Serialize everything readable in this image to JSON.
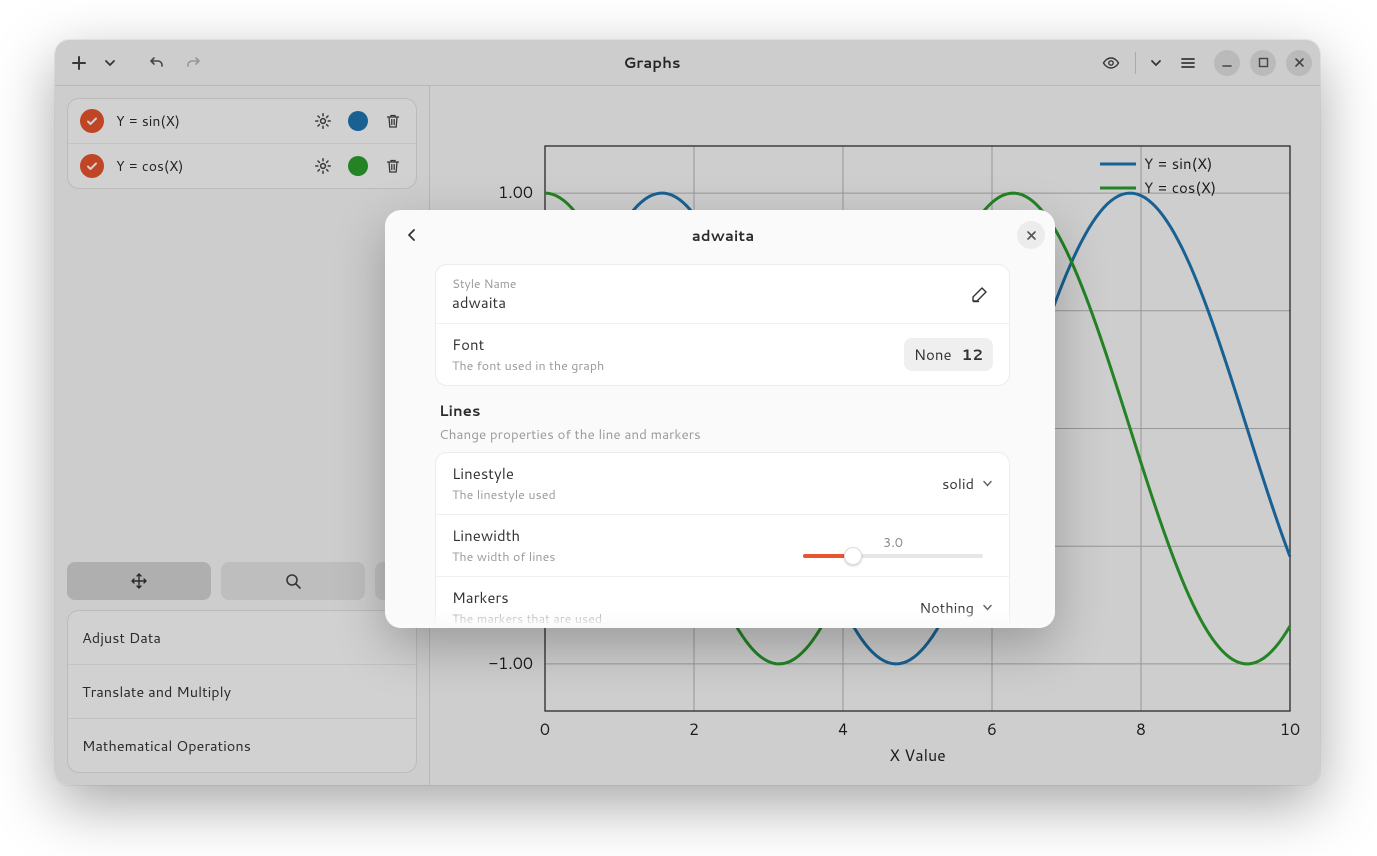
{
  "header": {
    "title": "Graphs"
  },
  "sidebar": {
    "equations": [
      {
        "label": "Y = sin(X)",
        "color": "#1f77b4"
      },
      {
        "label": "Y = cos(X)",
        "color": "#2ca02c"
      }
    ],
    "accordion": [
      "Adjust Data",
      "Translate and Multiply",
      "Mathematical Operations"
    ]
  },
  "chart": {
    "xlabel": "X Value",
    "legend": [
      "Y = sin(X)",
      "Y = cos(X)"
    ],
    "yticks": [
      "1.00",
      "−1.00"
    ],
    "xticks": [
      "0",
      "2",
      "4",
      "6",
      "8",
      "10"
    ]
  },
  "chart_data": {
    "type": "line",
    "title": "",
    "xlabel": "X Value",
    "ylabel": "",
    "xlim": [
      0,
      10
    ],
    "ylim": [
      -1.2,
      1.2
    ],
    "x": [
      0,
      0.5,
      1,
      1.5,
      2,
      2.5,
      3,
      3.5,
      4,
      4.5,
      5,
      5.5,
      6,
      6.5,
      7,
      7.5,
      8,
      8.5,
      9,
      9.5,
      10
    ],
    "series": [
      {
        "name": "Y = sin(X)",
        "color": "#1f77b4",
        "values": [
          0,
          0.479,
          0.841,
          0.997,
          0.909,
          0.599,
          0.141,
          -0.351,
          -0.757,
          -0.978,
          -0.959,
          -0.706,
          -0.279,
          0.215,
          0.657,
          0.938,
          0.989,
          0.798,
          0.412,
          -0.075,
          -0.544
        ]
      },
      {
        "name": "Y = cos(X)",
        "color": "#2ca02c",
        "values": [
          1,
          0.878,
          0.54,
          0.071,
          -0.416,
          -0.801,
          -0.99,
          -0.936,
          -0.654,
          -0.211,
          0.284,
          0.709,
          0.96,
          0.977,
          0.754,
          0.347,
          -0.146,
          -0.602,
          -0.911,
          -0.997,
          -0.839
        ]
      }
    ]
  },
  "dialog": {
    "title": "adwaita",
    "style_name_label": "Style Name",
    "style_name_value": "adwaita",
    "font_label": "Font",
    "font_sub": "The font used in the graph",
    "font_name": "None",
    "font_size": "12",
    "lines_title": "Lines",
    "lines_sub": "Change properties of the line and markers",
    "linestyle_label": "Linestyle",
    "linestyle_sub": "The linestyle used",
    "linestyle_value": "solid",
    "linewidth_label": "Linewidth",
    "linewidth_sub": "The width of lines",
    "linewidth_value": "3.0",
    "markers_label": "Markers",
    "markers_sub": "The markers that are used",
    "markers_value": "Nothing"
  }
}
